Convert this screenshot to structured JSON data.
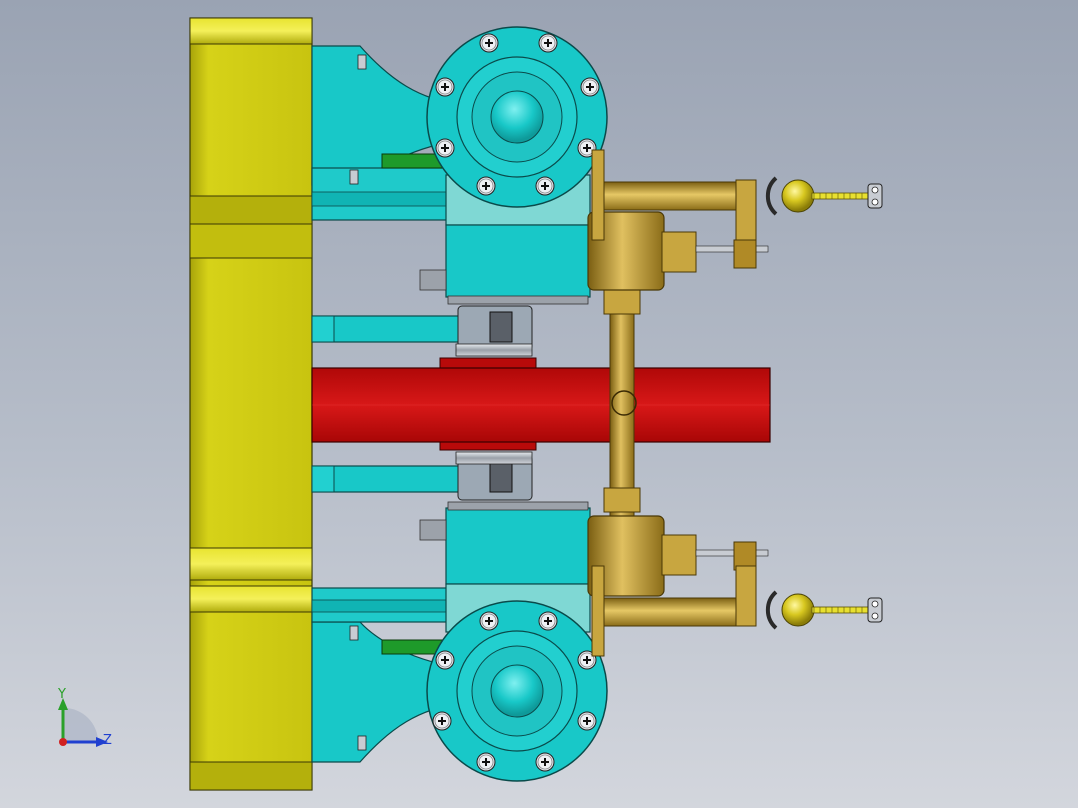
{
  "viewport": {
    "background_top": "#9aa3b3",
    "background_bottom": "#d3d6dd"
  },
  "colors": {
    "yellow_block": "#d0cc10",
    "cyan_parts": "#18c8c8",
    "red_flywheel": "#cc1010",
    "brass": "#b8962a",
    "green_bars": "#1e9a2a",
    "steel": "#b8bcc4"
  },
  "icons": [
    "phillips-screw-icon",
    "ball-handle-icon",
    "axis-triad-icon"
  ],
  "triad": {
    "x_label": "",
    "y_label": "Y",
    "z_label": "Z",
    "y_color": "#2aa02a",
    "z_color": "#2040d0",
    "x_color": "#d02020"
  }
}
